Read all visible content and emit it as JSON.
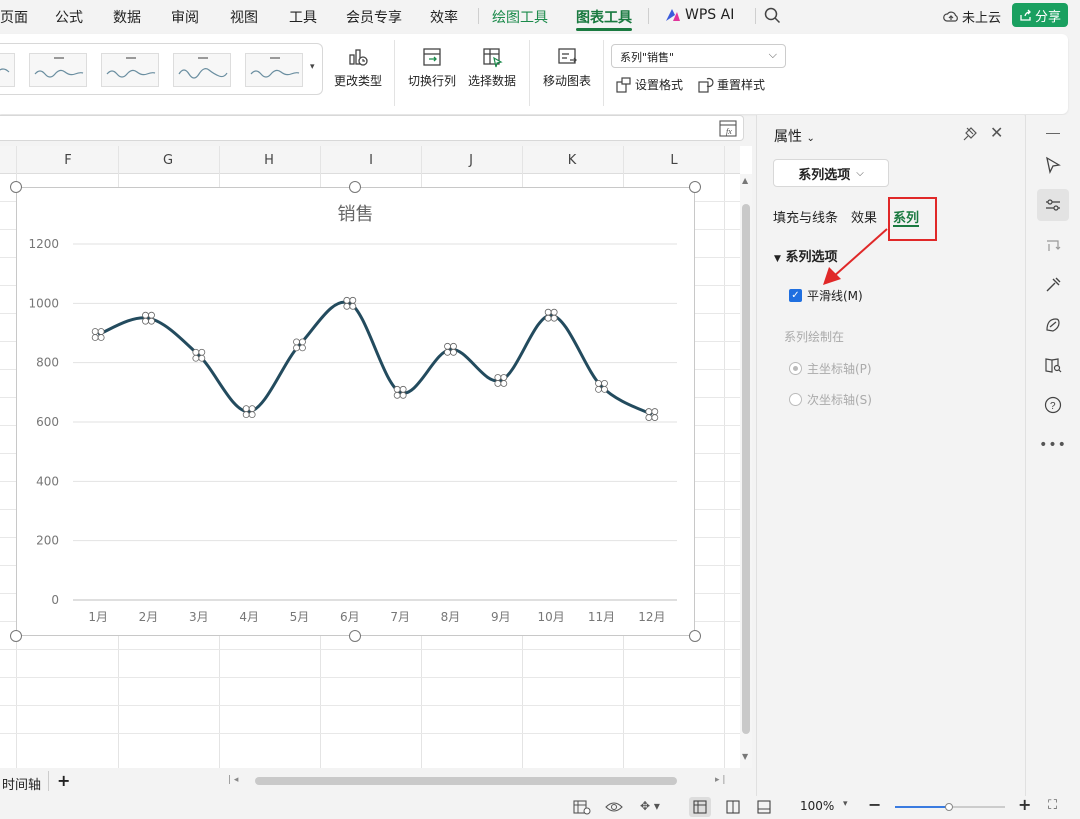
{
  "menubar": {
    "items": [
      "页面",
      "公式",
      "数据",
      "审阅",
      "视图",
      "工具",
      "会员专享",
      "效率",
      "绘图工具",
      "图表工具",
      "WPS AI"
    ],
    "cloud_label": "未上云",
    "share_label": "分享"
  },
  "ribbon": {
    "change_type": "更改类型",
    "switch_rowcol": "切换行列",
    "select_data": "选择数据",
    "move_chart": "移动图表",
    "series_select": "系列\"销售\"",
    "format_settings": "设置格式",
    "reset_style": "重置样式"
  },
  "sheet": {
    "columns": [
      "F",
      "G",
      "H",
      "I",
      "J",
      "K",
      "L"
    ],
    "tab_name": "时间轴",
    "add_tab": "+"
  },
  "chart_data": {
    "type": "line",
    "title": "销售",
    "categories": [
      "1月",
      "2月",
      "3月",
      "4月",
      "5月",
      "6月",
      "7月",
      "8月",
      "9月",
      "10月",
      "11月",
      "12月"
    ],
    "series": [
      {
        "values": [
          895,
          950,
          825,
          635,
          860,
          1000,
          700,
          845,
          740,
          960,
          720,
          625
        ]
      }
    ],
    "smooth": true,
    "ylim": [
      0,
      1200
    ],
    "yticks": [
      "0",
      "200",
      "400",
      "600",
      "800",
      "1000",
      "1200"
    ],
    "grid": true,
    "line_color": "#234b5e"
  },
  "panel": {
    "title": "属性",
    "dropdown": "系列选项",
    "tabs": [
      "填充与线条",
      "效果",
      "系列"
    ],
    "section_title": "系列选项",
    "smooth_label": "平滑线(M)",
    "plot_on_label": "系列绘制在",
    "primary_axis": "主坐标轴(P)",
    "secondary_axis": "次坐标轴(S)"
  },
  "statusbar": {
    "zoom": "100%"
  },
  "colors": {
    "accent_green": "#1a7a40",
    "share_green": "#1aa060",
    "highlight_red": "#e02828"
  }
}
